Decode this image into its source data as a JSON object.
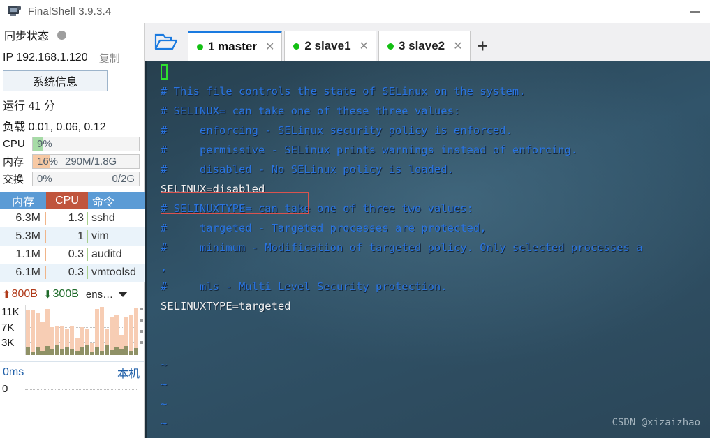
{
  "window": {
    "title": "FinalShell 3.9.3.4",
    "app_icon": "monitor-icon",
    "minimize_label": "—"
  },
  "sidebar": {
    "sync": {
      "label": "同步状态",
      "status_icon": "status-dot",
      "status_color": "#9e9e9e"
    },
    "ip": {
      "text": "IP 192.168.1.120",
      "copy_label": "复制"
    },
    "sysinfo_button": "系统信息",
    "uptime": "运行 41 分",
    "load": "负载 0.01, 0.06, 0.12",
    "meters": [
      {
        "name": "cpu",
        "label": "CPU",
        "percent": "9%",
        "detail": "",
        "fill": 9,
        "color": "#a6dba6"
      },
      {
        "name": "mem",
        "label": "内存",
        "percent": "16%",
        "detail": "290M/1.8G",
        "fill": 16,
        "color": "#f7c9a4"
      },
      {
        "name": "swap",
        "label": "交换",
        "percent": "0%",
        "detail": "0/2G",
        "fill": 0,
        "color": "#f4f4f4"
      }
    ],
    "process_table": {
      "headers": {
        "mem": "内存",
        "cpu": "CPU",
        "cmd": "命令"
      },
      "header_bg": "#5b9bd5",
      "cpu_header_bg": "#c0553d",
      "rows": [
        {
          "mem": "6.3M",
          "cpu": "1.3",
          "cmd": "sshd"
        },
        {
          "mem": "5.3M",
          "cpu": "1",
          "cmd": "vim"
        },
        {
          "mem": "1.1M",
          "cpu": "0.3",
          "cmd": "auditd"
        },
        {
          "mem": "6.1M",
          "cpu": "0.3",
          "cmd": "vmtoolsd"
        }
      ]
    },
    "network": {
      "up_arrow": "arrow-up-icon",
      "up_value": "800B",
      "down_arrow": "arrow-down-icon",
      "down_value": "300B",
      "interface": "ens…",
      "caret_icon": "chevron-down-icon",
      "axis_labels": [
        "11K",
        "7K",
        "3K"
      ]
    },
    "latency": {
      "value": "0ms",
      "host": "本机",
      "zero_label": "0"
    }
  },
  "tabs": {
    "folder_icon": "open-folder-icon",
    "add_icon": "plus-icon",
    "items": [
      {
        "label": "1 master",
        "active": true,
        "status_color": "#13c013",
        "close_icon": "close-icon"
      },
      {
        "label": "2 slave1",
        "active": false,
        "status_color": "#13c013",
        "close_icon": "close-icon"
      },
      {
        "label": "3 slave2",
        "active": false,
        "status_color": "#13c013",
        "close_icon": "close-icon"
      }
    ]
  },
  "terminal": {
    "background": "#2d4b5e",
    "comment_color": "#2a74e0",
    "text_color": "#f2f2f2",
    "cursor_color": "#2ee02e",
    "highlight_box_color": "#d9534f",
    "lines": [
      {
        "text": "# This file controls the state of SELinux on the system.",
        "style": "cmt"
      },
      {
        "text": "# SELINUX= can take one of these three values:",
        "style": "cmt"
      },
      {
        "text": "#     enforcing - SELinux security policy is enforced.",
        "style": "cmt"
      },
      {
        "text": "#     permissive - SELinux prints warnings instead of enforcing.",
        "style": "cmt"
      },
      {
        "text": "#     disabled - No SELinux policy is loaded.",
        "style": "cmt"
      },
      {
        "text": "SELINUX=disabled",
        "style": "plain"
      },
      {
        "text": "# SELINUXTYPE= can take one of three two values:",
        "style": "cmt"
      },
      {
        "text": "#     targeted - Targeted processes are protected,",
        "style": "cmt"
      },
      {
        "text": "#     minimum - Modification of targeted policy. Only selected processes a",
        "style": "cmt"
      },
      {
        "text": ",",
        "style": "cmt"
      },
      {
        "text": "#     mls - Multi Level Security protection.",
        "style": "cmt"
      },
      {
        "text": "SELINUXTYPE=targeted",
        "style": "plain"
      },
      {
        "text": "",
        "style": "cmt"
      },
      {
        "text": "",
        "style": "cmt"
      },
      {
        "text": "~",
        "style": "cmt"
      },
      {
        "text": "~",
        "style": "cmt"
      },
      {
        "text": "~",
        "style": "cmt"
      },
      {
        "text": "~",
        "style": "cmt"
      }
    ],
    "watermark": "CSDN @xizaizhao"
  },
  "chart_data": {
    "type": "bar",
    "title": "network traffic",
    "ylabel": "",
    "ytick_labels": [
      "11K",
      "7K",
      "3K"
    ],
    "ylim": [
      0,
      13000
    ],
    "grid": true,
    "series": [
      {
        "name": "upload",
        "color": "#f7cdb4",
        "values": [
          11500,
          11800,
          10800,
          8500,
          11900,
          7200,
          7400,
          7300,
          6800,
          7600,
          4200,
          7100,
          6900,
          3100,
          11900,
          12400,
          6600,
          9600,
          10300,
          5100,
          9800,
          10500,
          12200
        ]
      },
      {
        "name": "download",
        "color": "#8f9166",
        "values": [
          2100,
          900,
          2000,
          1100,
          2300,
          1500,
          2600,
          1400,
          1900,
          1500,
          1000,
          1900,
          2500,
          900,
          2000,
          1100,
          2700,
          1200,
          2100,
          1500,
          2400,
          1100,
          1800
        ]
      }
    ]
  }
}
